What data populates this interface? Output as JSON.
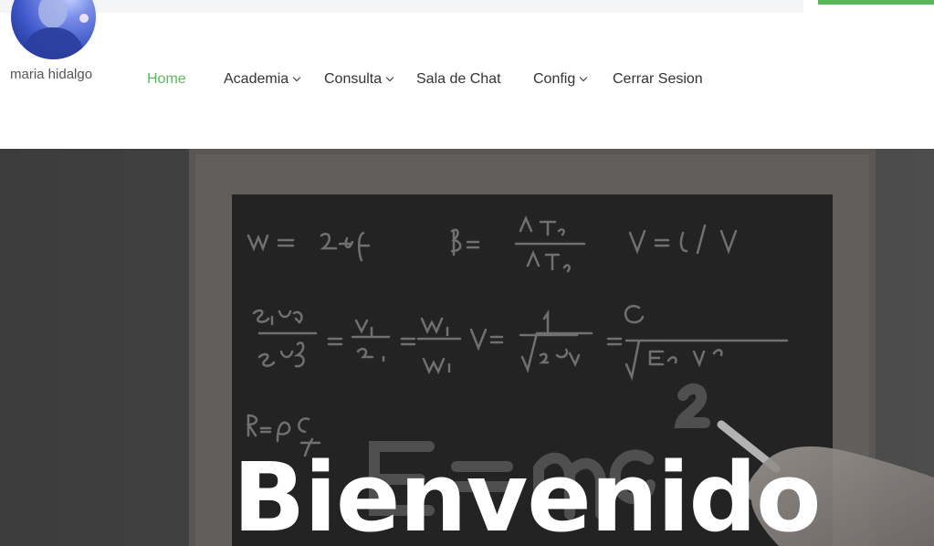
{
  "user": {
    "name": "maria hidalgo",
    "avatar_icon": "user-avatar-icon"
  },
  "nav": {
    "items": [
      {
        "label": "Home",
        "active": true,
        "dropdown": false
      },
      {
        "label": "Academia",
        "active": false,
        "dropdown": true
      },
      {
        "label": "Consulta",
        "active": false,
        "dropdown": true
      },
      {
        "label": "Sala de Chat",
        "active": false,
        "dropdown": false
      },
      {
        "label": "Config",
        "active": false,
        "dropdown": true
      },
      {
        "label": "Cerrar Sesion",
        "active": false,
        "dropdown": false
      }
    ]
  },
  "hero": {
    "title": "Bienvenido"
  },
  "colors": {
    "accent": "#5cb85c",
    "nav_text": "#333333",
    "hero_bg": "#5a5a5a"
  }
}
